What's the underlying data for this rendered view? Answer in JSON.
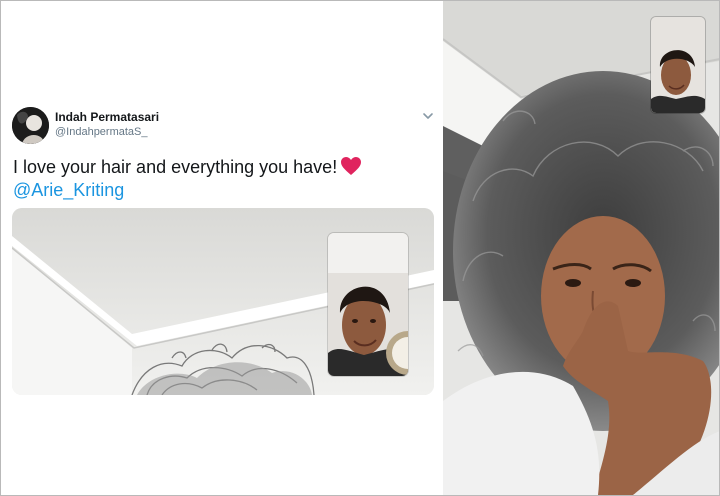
{
  "tweet": {
    "user_name": "Indah Permatasari",
    "user_handle": "@IndahpermataS_",
    "text": "I love your hair and everything you have!",
    "mention": "@Arie_Kriting",
    "icons": {
      "avatar": "profile-avatar",
      "menu": "chevron-down-icon",
      "emoji": "heart-icon"
    }
  },
  "colors": {
    "text": "#14171a",
    "secondary": "#657786",
    "link": "#1b95e0",
    "heart": "#e0245e"
  }
}
